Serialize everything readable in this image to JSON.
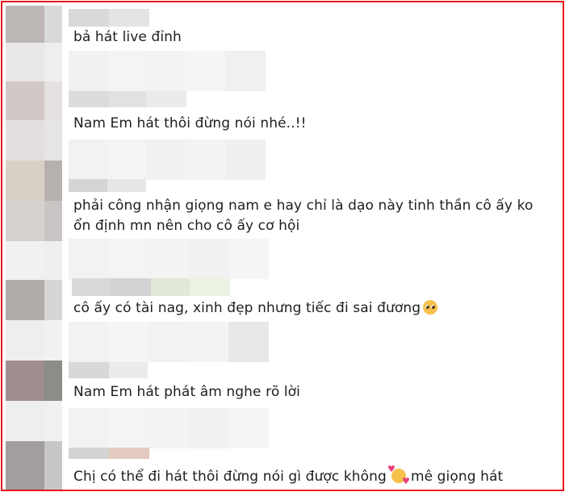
{
  "comments": [
    {
      "text": "bả hát live đỉnh"
    },
    {
      "text": "Nam Em hát thôi đừng nói nhé..!!"
    },
    {
      "text": "phải công nhận giọng nam e hay chỉ là dạo này tinh thần cô ấy ko ổn định mn nên cho cô ấy cơ hội"
    },
    {
      "text": "cô ấy có tài nag, xinh đẹp nhưng tiếc đi sai đương",
      "emoji": "pleading-face-icon"
    },
    {
      "text": "Nam Em hát phát âm nghe rõ lời"
    },
    {
      "text": "Chị có thể đi hát thôi đừng nói gì được không",
      "emoji": "smiling-face-with-hearts-icon",
      "text_after": "mê giọng hát"
    }
  ],
  "colors": {
    "border": "#e8141b",
    "text": "#1c1e21"
  }
}
